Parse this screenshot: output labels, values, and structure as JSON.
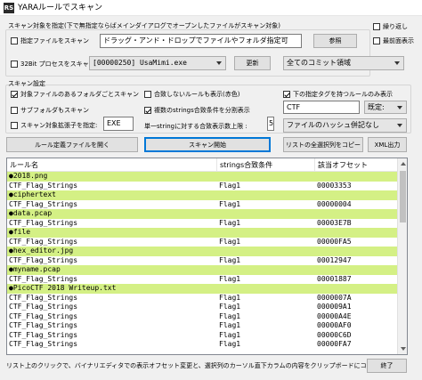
{
  "window": {
    "app_icon": "RS",
    "title": "YARAルールでスキャン"
  },
  "target": {
    "group_label": "スキャン対象を指定(下で無指定ならばメインダイアログでオープンしたファイルがスキャン対象)",
    "file_checkbox": {
      "label": "指定ファイルをスキャン",
      "checked": false
    },
    "file_input_value": "ドラッグ・アンド・ドロップでファイルやフォルダ指定可",
    "browse_label": "参照",
    "process_checkbox": {
      "label": "32Bit プロセスをスキャン",
      "checked": false
    },
    "process_select_value": "[00000250] UsaMimi.exe",
    "refresh_label": "更新",
    "region_select_value": "全てのコミット領域",
    "always_on_top": {
      "label": "繰り返し",
      "checked": false
    },
    "minimize": {
      "label": "最前面表示",
      "checked": false
    }
  },
  "settings": {
    "group_label": "スキャン設定",
    "folder_scan": {
      "label": "対象ファイルのあるフォルダごとスキャン",
      "checked": true
    },
    "subfolder": {
      "label": "サブフォルダもスキャン",
      "checked": false
    },
    "ext_filter": {
      "label": "スキャン対象拡張子を指定:",
      "checked": false
    },
    "ext_value": "EXE",
    "show_unmatched": {
      "label": "合致しないルールも表示(赤色)",
      "checked": false
    },
    "split_strings": {
      "label": "複数のstrings合致条件を分割表示",
      "checked": true
    },
    "single_string_label": "単一stringに対する合致表示数上限 :",
    "single_string_value": "5",
    "tag_filter": {
      "label": "下の指定タグを持つルールのみ表示",
      "checked": false
    },
    "tag_value": "CTF",
    "tag_mode_value": "既定:",
    "hash_select_value": "ファイルのハッシュ併記なし"
  },
  "actions": {
    "open_rule_label": "ルール定義ファイルを開く",
    "scan_label": "スキャン開始",
    "copy_list_label": "リストの全選択列をコピー",
    "xml_label": "XML出力"
  },
  "list": {
    "columns": [
      "ルール名",
      "strings合致条件",
      "該当オフセット"
    ],
    "rows": [
      {
        "type": "file",
        "c1": "●2018.png"
      },
      {
        "type": "data",
        "c1": "CTF_Flag_Strings",
        "c2": "Flag1",
        "c3": "00003353"
      },
      {
        "type": "file",
        "c1": "●ciphertext"
      },
      {
        "type": "data",
        "c1": "CTF_Flag_Strings",
        "c2": "Flag1",
        "c3": "00000004"
      },
      {
        "type": "file",
        "c1": "●data.pcap"
      },
      {
        "type": "data",
        "c1": "CTF_Flag_Strings",
        "c2": "Flag1",
        "c3": "00003E7B"
      },
      {
        "type": "file",
        "c1": "●file"
      },
      {
        "type": "data",
        "c1": "CTF_Flag_Strings",
        "c2": "Flag1",
        "c3": "00000FA5"
      },
      {
        "type": "file",
        "c1": "●hex_editor.jpg"
      },
      {
        "type": "data",
        "c1": "CTF_Flag_Strings",
        "c2": "Flag1",
        "c3": "00012947"
      },
      {
        "type": "file",
        "c1": "●myname.pcap"
      },
      {
        "type": "data",
        "c1": "CTF_Flag_Strings",
        "c2": "Flag1",
        "c3": "00001887"
      },
      {
        "type": "file",
        "c1": "●PicoCTF 2018 Writeup.txt"
      },
      {
        "type": "data",
        "c1": "CTF_Flag_Strings",
        "c2": "Flag1",
        "c3": "0000007A"
      },
      {
        "type": "data",
        "c1": "CTF_Flag_Strings",
        "c2": "Flag1",
        "c3": "000009A1"
      },
      {
        "type": "data",
        "c1": "CTF_Flag_Strings",
        "c2": "Flag1",
        "c3": "00000A4E"
      },
      {
        "type": "data",
        "c1": "CTF_Flag_Strings",
        "c2": "Flag1",
        "c3": "00000AF0"
      },
      {
        "type": "data",
        "c1": "CTF_Flag_Strings",
        "c2": "Flag1",
        "c3": "00000C6D"
      },
      {
        "type": "data",
        "c1": "CTF_Flag_Strings",
        "c2": "Flag1",
        "c3": "00000FA7"
      }
    ]
  },
  "footer": {
    "hint": "リスト上のクリックで、バイナリエディタでの表示オフセット変更と、選択列のカーソル直下カラムの内容をクリップボードにコピー",
    "close_label": "終了"
  },
  "colors": {
    "file_row_highlight": "#d4f085",
    "focus_border": "#0078d7"
  }
}
